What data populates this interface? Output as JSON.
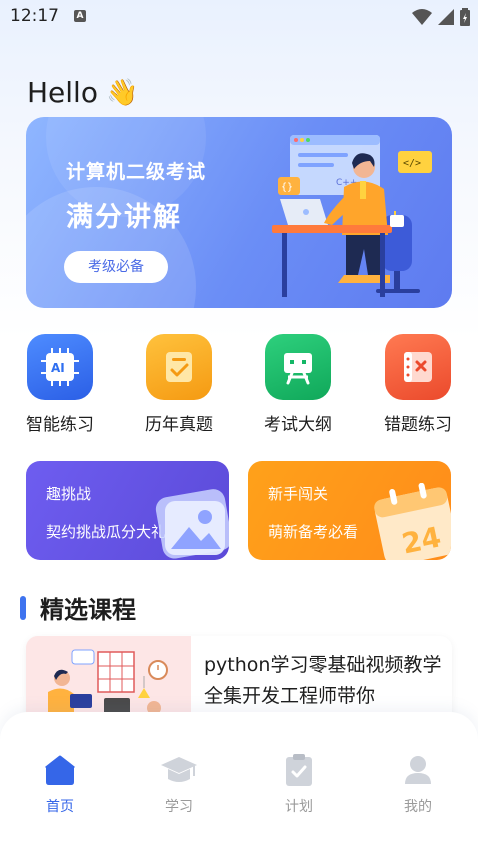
{
  "status_bar": {
    "time": "12:17",
    "notif": "A"
  },
  "greeting": {
    "text": "Hello",
    "emoji": "👋"
  },
  "banner": {
    "subtitle": "计算机二级考试",
    "title": "满分讲解",
    "button_label": "考级必备",
    "illus_tag_code": "</>",
    "illus_tag_braces": "{}",
    "illus_tag_cpp": "C++"
  },
  "quick_actions": [
    {
      "label": "智能练习",
      "icon": "ai-chip-icon",
      "color": "#2f6ff0"
    },
    {
      "label": "历年真题",
      "icon": "checklist-icon",
      "color": "#f7a21b"
    },
    {
      "label": "考试大纲",
      "icon": "easel-icon",
      "color": "#14b766"
    },
    {
      "label": "错题练习",
      "icon": "wrong-book-icon",
      "color": "#f0563a"
    }
  ],
  "cards": [
    {
      "title": "趣挑战",
      "subtitle": "契约挑战瓜分大礼",
      "color": "#6a5ae6"
    },
    {
      "title": "新手闯关",
      "subtitle": "萌新备考必看",
      "color": "#ff9c1a",
      "calendar_number": "24"
    }
  ],
  "section": {
    "title": "精选课程"
  },
  "course": {
    "title": "python学习零基础视频教学全集开发工程师带你"
  },
  "bottom_nav": [
    {
      "label": "首页",
      "icon": "home-icon",
      "active": true
    },
    {
      "label": "学习",
      "icon": "graduation-cap-icon",
      "active": false
    },
    {
      "label": "计划",
      "icon": "clipboard-check-icon",
      "active": false
    },
    {
      "label": "我的",
      "icon": "user-icon",
      "active": false
    }
  ],
  "colors": {
    "accent": "#3566e8",
    "inactive": "#cfd3da"
  }
}
